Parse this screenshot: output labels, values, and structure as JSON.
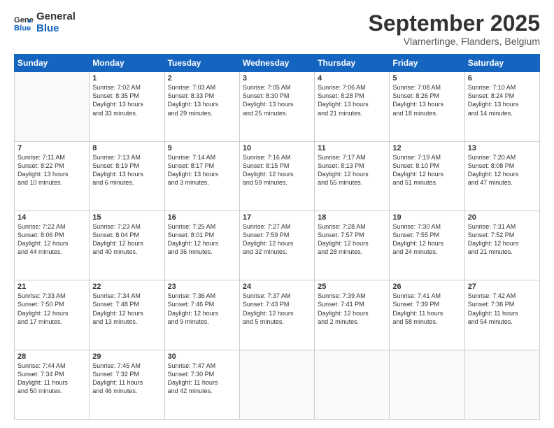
{
  "logo": {
    "line1": "General",
    "line2": "Blue"
  },
  "header": {
    "month": "September 2025",
    "location": "Vlamertinge, Flanders, Belgium"
  },
  "weekdays": [
    "Sunday",
    "Monday",
    "Tuesday",
    "Wednesday",
    "Thursday",
    "Friday",
    "Saturday"
  ],
  "weeks": [
    [
      {
        "day": "",
        "info": ""
      },
      {
        "day": "1",
        "info": "Sunrise: 7:02 AM\nSunset: 8:35 PM\nDaylight: 13 hours\nand 33 minutes."
      },
      {
        "day": "2",
        "info": "Sunrise: 7:03 AM\nSunset: 8:33 PM\nDaylight: 13 hours\nand 29 minutes."
      },
      {
        "day": "3",
        "info": "Sunrise: 7:05 AM\nSunset: 8:30 PM\nDaylight: 13 hours\nand 25 minutes."
      },
      {
        "day": "4",
        "info": "Sunrise: 7:06 AM\nSunset: 8:28 PM\nDaylight: 13 hours\nand 21 minutes."
      },
      {
        "day": "5",
        "info": "Sunrise: 7:08 AM\nSunset: 8:26 PM\nDaylight: 13 hours\nand 18 minutes."
      },
      {
        "day": "6",
        "info": "Sunrise: 7:10 AM\nSunset: 8:24 PM\nDaylight: 13 hours\nand 14 minutes."
      }
    ],
    [
      {
        "day": "7",
        "info": "Sunrise: 7:11 AM\nSunset: 8:22 PM\nDaylight: 13 hours\nand 10 minutes."
      },
      {
        "day": "8",
        "info": "Sunrise: 7:13 AM\nSunset: 8:19 PM\nDaylight: 13 hours\nand 6 minutes."
      },
      {
        "day": "9",
        "info": "Sunrise: 7:14 AM\nSunset: 8:17 PM\nDaylight: 13 hours\nand 3 minutes."
      },
      {
        "day": "10",
        "info": "Sunrise: 7:16 AM\nSunset: 8:15 PM\nDaylight: 12 hours\nand 59 minutes."
      },
      {
        "day": "11",
        "info": "Sunrise: 7:17 AM\nSunset: 8:13 PM\nDaylight: 12 hours\nand 55 minutes."
      },
      {
        "day": "12",
        "info": "Sunrise: 7:19 AM\nSunset: 8:10 PM\nDaylight: 12 hours\nand 51 minutes."
      },
      {
        "day": "13",
        "info": "Sunrise: 7:20 AM\nSunset: 8:08 PM\nDaylight: 12 hours\nand 47 minutes."
      }
    ],
    [
      {
        "day": "14",
        "info": "Sunrise: 7:22 AM\nSunset: 8:06 PM\nDaylight: 12 hours\nand 44 minutes."
      },
      {
        "day": "15",
        "info": "Sunrise: 7:23 AM\nSunset: 8:04 PM\nDaylight: 12 hours\nand 40 minutes."
      },
      {
        "day": "16",
        "info": "Sunrise: 7:25 AM\nSunset: 8:01 PM\nDaylight: 12 hours\nand 36 minutes."
      },
      {
        "day": "17",
        "info": "Sunrise: 7:27 AM\nSunset: 7:59 PM\nDaylight: 12 hours\nand 32 minutes."
      },
      {
        "day": "18",
        "info": "Sunrise: 7:28 AM\nSunset: 7:57 PM\nDaylight: 12 hours\nand 28 minutes."
      },
      {
        "day": "19",
        "info": "Sunrise: 7:30 AM\nSunset: 7:55 PM\nDaylight: 12 hours\nand 24 minutes."
      },
      {
        "day": "20",
        "info": "Sunrise: 7:31 AM\nSunset: 7:52 PM\nDaylight: 12 hours\nand 21 minutes."
      }
    ],
    [
      {
        "day": "21",
        "info": "Sunrise: 7:33 AM\nSunset: 7:50 PM\nDaylight: 12 hours\nand 17 minutes."
      },
      {
        "day": "22",
        "info": "Sunrise: 7:34 AM\nSunset: 7:48 PM\nDaylight: 12 hours\nand 13 minutes."
      },
      {
        "day": "23",
        "info": "Sunrise: 7:36 AM\nSunset: 7:46 PM\nDaylight: 12 hours\nand 9 minutes."
      },
      {
        "day": "24",
        "info": "Sunrise: 7:37 AM\nSunset: 7:43 PM\nDaylight: 12 hours\nand 5 minutes."
      },
      {
        "day": "25",
        "info": "Sunrise: 7:39 AM\nSunset: 7:41 PM\nDaylight: 12 hours\nand 2 minutes."
      },
      {
        "day": "26",
        "info": "Sunrise: 7:41 AM\nSunset: 7:39 PM\nDaylight: 11 hours\nand 58 minutes."
      },
      {
        "day": "27",
        "info": "Sunrise: 7:42 AM\nSunset: 7:36 PM\nDaylight: 11 hours\nand 54 minutes."
      }
    ],
    [
      {
        "day": "28",
        "info": "Sunrise: 7:44 AM\nSunset: 7:34 PM\nDaylight: 11 hours\nand 50 minutes."
      },
      {
        "day": "29",
        "info": "Sunrise: 7:45 AM\nSunset: 7:32 PM\nDaylight: 11 hours\nand 46 minutes."
      },
      {
        "day": "30",
        "info": "Sunrise: 7:47 AM\nSunset: 7:30 PM\nDaylight: 11 hours\nand 42 minutes."
      },
      {
        "day": "",
        "info": ""
      },
      {
        "day": "",
        "info": ""
      },
      {
        "day": "",
        "info": ""
      },
      {
        "day": "",
        "info": ""
      }
    ]
  ]
}
